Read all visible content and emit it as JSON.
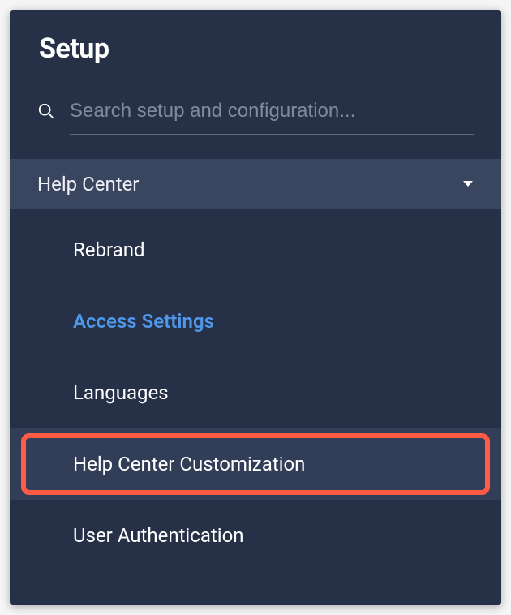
{
  "panel": {
    "title": "Setup"
  },
  "search": {
    "placeholder": "Search setup and configuration..."
  },
  "section": {
    "title": "Help Center"
  },
  "nav": {
    "items": [
      {
        "label": "Rebrand"
      },
      {
        "label": "Access Settings"
      },
      {
        "label": "Languages"
      },
      {
        "label": "Help Center Customization"
      },
      {
        "label": "User Authentication"
      }
    ]
  }
}
